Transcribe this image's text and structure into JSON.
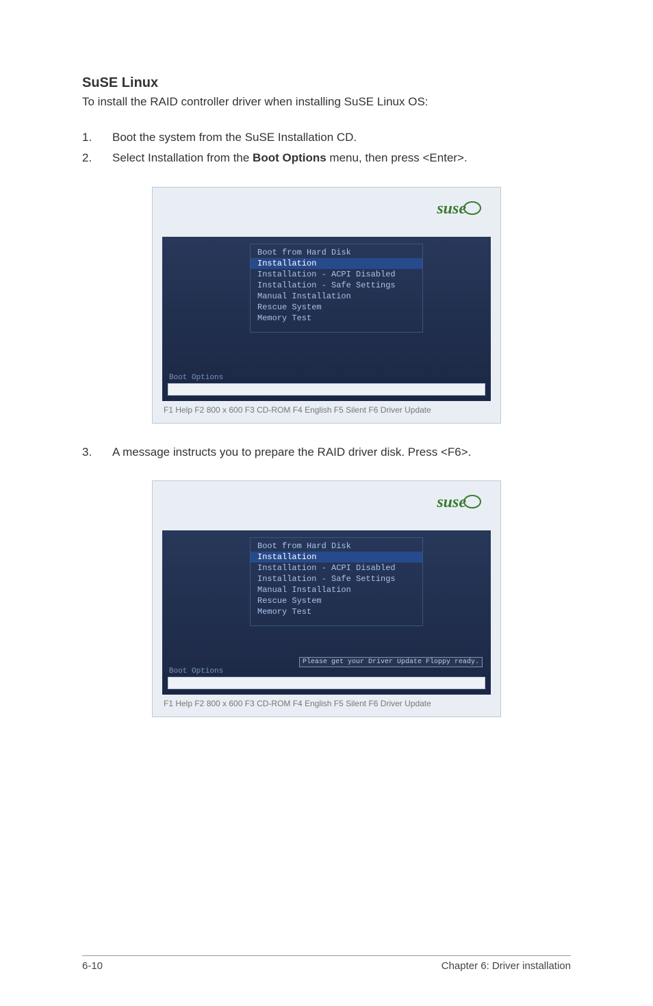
{
  "heading": "SuSE Linux",
  "intro": "To install the RAID controller driver when installing SuSE Linux OS:",
  "steps_a": [
    {
      "n": "1.",
      "t": "Boot the system from the SuSE Installation CD."
    },
    {
      "n": "2.",
      "t_pre": "Select Installation from the ",
      "t_b": "Boot Options",
      "t_post": " menu, then press <Enter>."
    }
  ],
  "steps_b": [
    {
      "n": "3.",
      "t": "A message instructs you to prepare the RAID driver disk. Press <F6>."
    }
  ],
  "shot": {
    "logo": "suse",
    "menu": [
      "Boot from Hard Disk",
      "Installation",
      "Installation - ACPI Disabled",
      "Installation - Safe Settings",
      "Manual Installation",
      "Rescue System",
      "Memory Test"
    ],
    "selected": "Installation",
    "boot_options_label": "Boot Options",
    "fkeys": "F1 Help   F2 800 x 600   F3 CD-ROM   F4 English   F5 Silent   F6 Driver Update",
    "floppy_msg": "Please get your Driver Update Floppy ready."
  },
  "footer": {
    "left": "6-10",
    "right": "Chapter 6: Driver installation"
  }
}
